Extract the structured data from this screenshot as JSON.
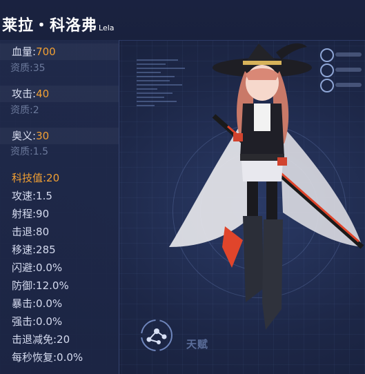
{
  "title": {
    "name": "莱拉・科洛弗",
    "sub": "Lela"
  },
  "stats": {
    "hp": {
      "label": "血量:",
      "value": "700",
      "grade": "资质:35"
    },
    "atk": {
      "label": "攻击:",
      "value": "40",
      "grade": "资质:2"
    },
    "arcane": {
      "label": "奥义:",
      "value": "30",
      "grade": "资质:1.5"
    }
  },
  "tech": "科技值:20",
  "extra_stats": [
    "攻速:1.5",
    "射程:90",
    "击退:80",
    "移速:285",
    "闪避:0.0%",
    "防御:12.0%",
    "暴击:0.0%",
    "强击:0.0%",
    "击退减免:20",
    "每秒恢复:0.0%"
  ],
  "talent": {
    "label": "天赋",
    "icon": "talent-network-icon"
  },
  "colors": {
    "accent": "#f2a033",
    "panel": "#202a4b",
    "background": "#1b2440"
  }
}
